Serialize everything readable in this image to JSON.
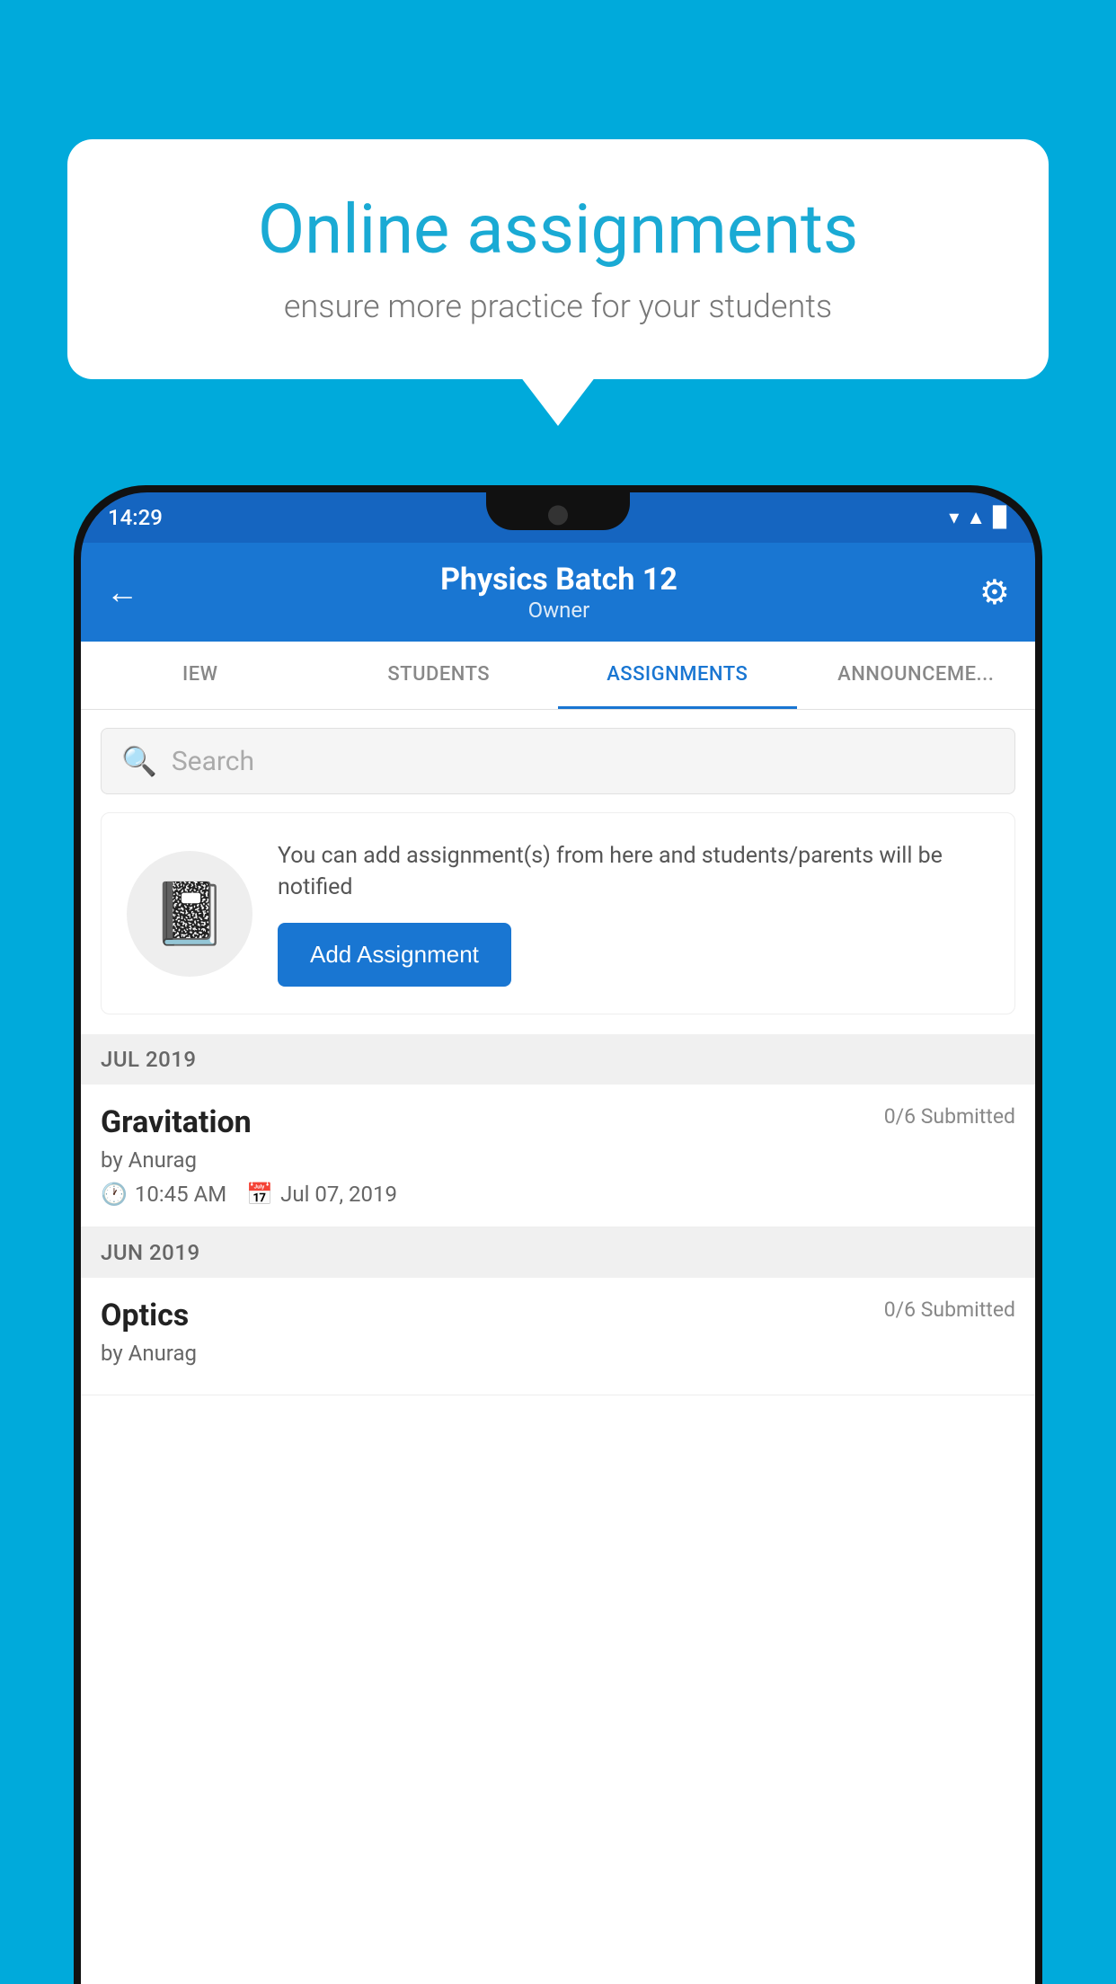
{
  "background": {
    "color": "#00AADB"
  },
  "speech_bubble": {
    "title": "Online assignments",
    "subtitle": "ensure more practice for your students"
  },
  "status_bar": {
    "time": "14:29",
    "wifi": "▼",
    "signal": "▲",
    "battery": "▉"
  },
  "header": {
    "title": "Physics Batch 12",
    "subtitle": "Owner",
    "back_label": "←",
    "settings_label": "⚙"
  },
  "tabs": [
    {
      "label": "IEW",
      "active": false
    },
    {
      "label": "STUDENTS",
      "active": false
    },
    {
      "label": "ASSIGNMENTS",
      "active": true
    },
    {
      "label": "ANNOUNCEMENTS",
      "active": false
    }
  ],
  "search": {
    "placeholder": "Search"
  },
  "info_card": {
    "icon": "📓",
    "text": "You can add assignment(s) from here and students/parents will be notified",
    "button_label": "Add Assignment"
  },
  "sections": [
    {
      "label": "JUL 2019",
      "assignments": [
        {
          "name": "Gravitation",
          "submitted": "0/6 Submitted",
          "by": "by Anurag",
          "time": "10:45 AM",
          "date": "Jul 07, 2019"
        }
      ]
    },
    {
      "label": "JUN 2019",
      "assignments": [
        {
          "name": "Optics",
          "submitted": "0/6 Submitted",
          "by": "by Anurag",
          "time": "",
          "date": ""
        }
      ]
    }
  ]
}
